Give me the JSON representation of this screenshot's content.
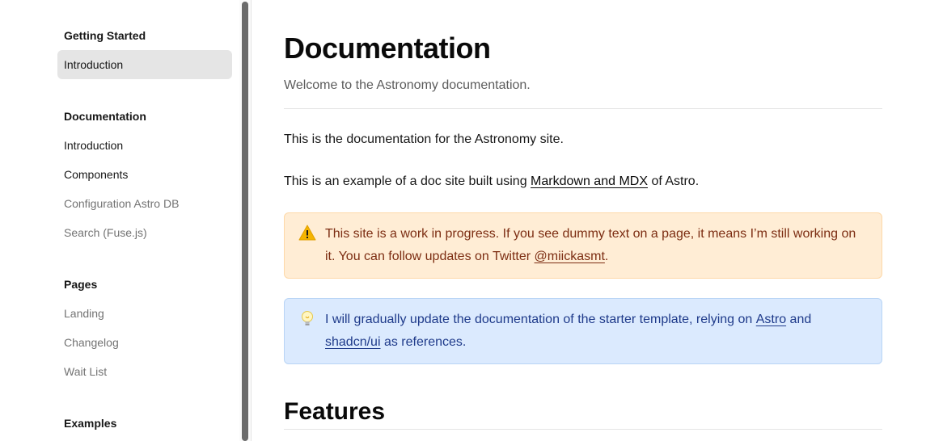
{
  "sidebar": {
    "sections": [
      {
        "title": "Getting Started",
        "items": [
          {
            "label": "Introduction"
          }
        ]
      },
      {
        "title": "Documentation",
        "items": [
          {
            "label": "Introduction"
          },
          {
            "label": "Components"
          },
          {
            "label": "Configuration Astro DB"
          },
          {
            "label": "Search (Fuse.js)"
          }
        ]
      },
      {
        "title": "Pages",
        "items": [
          {
            "label": "Landing"
          },
          {
            "label": "Changelog"
          },
          {
            "label": "Wait List"
          }
        ]
      },
      {
        "title": "Examples",
        "items": []
      }
    ]
  },
  "main": {
    "title": "Documentation",
    "description": "Welcome to the Astronomy documentation.",
    "paragraph1": "This is the documentation for the Astronomy site.",
    "paragraph2": {
      "before": "This is an example of a doc site built using ",
      "link": "Markdown and MDX",
      "after": " of Astro."
    },
    "warning": {
      "icon": "warning-icon",
      "text": "This site is a work in progress. If you see dummy text on a page, it means I’m still working on it. You can follow updates on Twitter ",
      "link": "@miickasmt",
      "after": "."
    },
    "info": {
      "icon": "lightbulb-icon",
      "text": "I will gradually update the documentation of the starter template, relying on ",
      "link1": "Astro",
      "middle": " and ",
      "link2": "shadcn/ui",
      "after": " as references."
    },
    "features_heading": "Features"
  },
  "colors": {
    "warning_bg": "#ffedd5",
    "warning_text": "#7c2d12",
    "info_bg": "#dbeafe",
    "info_text": "#1e3a8a",
    "active_item_bg": "#e5e5e5"
  }
}
